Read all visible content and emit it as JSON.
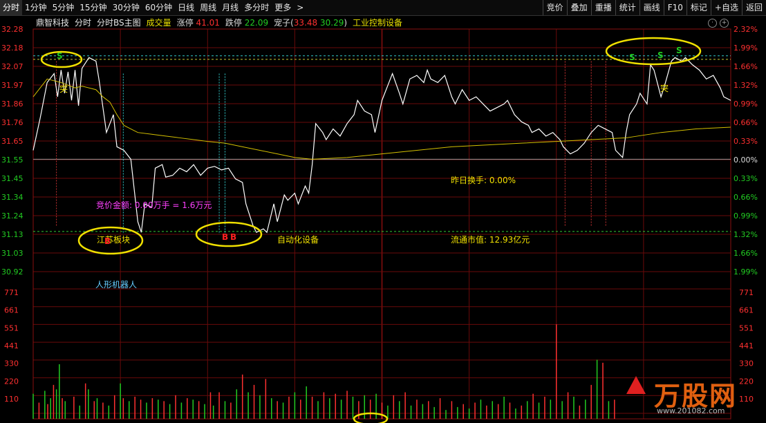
{
  "tabs": [
    {
      "label": "分时",
      "active": true
    },
    {
      "label": "1分钟"
    },
    {
      "label": "5分钟"
    },
    {
      "label": "15分钟"
    },
    {
      "label": "30分钟"
    },
    {
      "label": "60分钟"
    },
    {
      "label": "日线"
    },
    {
      "label": "周线"
    },
    {
      "label": "月线"
    },
    {
      "label": "多分时"
    },
    {
      "label": "更多"
    }
  ],
  "more_arrow": ">",
  "right_buttons": [
    "竞价",
    "叠加",
    "重播",
    "统计",
    "画线",
    "F10",
    "标记",
    "+自选",
    "返回"
  ],
  "info": {
    "stock_name": "鼎智科技",
    "chart_name": "分时",
    "indicator": "分时BS主图",
    "volume_label": "成交量",
    "limit_up_label": "涨停",
    "limit_up_value": "41.01",
    "limit_down_label": "跌停",
    "limit_down_value": "22.09",
    "pet_label": "宠子",
    "pet_open": "(",
    "pet_v1": "33.48",
    "pet_v2": "30.29",
    "pet_close": ")",
    "sector": "工业控制设备"
  },
  "colors": {
    "up": "#ff3030",
    "down": "#22cc22",
    "price_line": "#ffffff",
    "avg_line": "#d4c000",
    "yellow": "#f0e000",
    "magenta": "#ff40ff",
    "cyan": "#66ccff"
  },
  "annotations": {
    "turnover": "昨日换手: 0.00%",
    "auction": "竞价金额: 0.00万手 = 1.6万元",
    "float_mv": "流通市值: 12.93亿元",
    "concept1": "江苏板块",
    "concept2": "自动化设备",
    "concept3": "人形机器人",
    "tu1": "突",
    "tu2": "突",
    "b1": "B",
    "b2": "B",
    "b3": "B",
    "s1": "S",
    "s2": "S",
    "s3": "S",
    "s4": "S"
  },
  "watermark": "万股网",
  "watermark_url": "www.201082.com",
  "chart_data": {
    "type": "line",
    "price_axis": {
      "labels": [
        "32.28",
        "32.18",
        "32.07",
        "31.97",
        "31.86",
        "31.76",
        "31.65",
        "31.55",
        "31.45",
        "31.34",
        "31.24",
        "31.13",
        "31.03",
        "30.92"
      ]
    },
    "pct_axis": {
      "labels": [
        "2.32%",
        "1.99%",
        "1.66%",
        "1.32%",
        "0.99%",
        "0.66%",
        "0.33%",
        "0.00%",
        "0.33%",
        "0.66%",
        "0.99%",
        "1.32%",
        "1.66%",
        "1.99%"
      ]
    },
    "volume_axis": {
      "labels": [
        "771",
        "661",
        "551",
        "441",
        "330",
        "220",
        "110"
      ]
    },
    "ylim": [
      30.92,
      32.28
    ],
    "prev_close": 31.55,
    "series": [
      {
        "points": [
          [
            0,
            31.6
          ],
          [
            2,
            31.78
          ],
          [
            4,
            31.98
          ],
          [
            6,
            32.03
          ],
          [
            7,
            31.9
          ],
          [
            8,
            32.05
          ],
          [
            9,
            31.92
          ],
          [
            10,
            32.04
          ],
          [
            11,
            31.88
          ],
          [
            12,
            32.05
          ],
          [
            13,
            31.85
          ],
          [
            14,
            32.06
          ],
          [
            16,
            32.12
          ],
          [
            18,
            32.1
          ],
          [
            19,
            31.98
          ],
          [
            21,
            31.7
          ],
          [
            23,
            31.8
          ],
          [
            24,
            31.62
          ],
          [
            26,
            31.6
          ],
          [
            28,
            31.55
          ],
          [
            30,
            31.2
          ],
          [
            31,
            31.14
          ],
          [
            32,
            31.3
          ],
          [
            34,
            31.28
          ],
          [
            35,
            31.5
          ],
          [
            37,
            31.52
          ],
          [
            38,
            31.45
          ],
          [
            40,
            31.46
          ],
          [
            42,
            31.5
          ],
          [
            44,
            31.48
          ],
          [
            46,
            31.52
          ],
          [
            48,
            31.46
          ],
          [
            50,
            31.5
          ],
          [
            52,
            31.51
          ],
          [
            54,
            31.49
          ],
          [
            56,
            31.5
          ],
          [
            58,
            31.44
          ],
          [
            60,
            31.42
          ],
          [
            61,
            31.3
          ],
          [
            63,
            31.18
          ],
          [
            64,
            31.14
          ],
          [
            66,
            31.16
          ],
          [
            67,
            31.14
          ],
          [
            69,
            31.3
          ],
          [
            70,
            31.2
          ],
          [
            72,
            31.35
          ],
          [
            73,
            31.32
          ],
          [
            75,
            31.36
          ],
          [
            76,
            31.3
          ],
          [
            78,
            31.4
          ],
          [
            79,
            31.36
          ],
          [
            80,
            31.52
          ],
          [
            81,
            31.75
          ],
          [
            83,
            31.7
          ],
          [
            84,
            31.66
          ],
          [
            86,
            31.72
          ],
          [
            88,
            31.68
          ],
          [
            90,
            31.75
          ],
          [
            92,
            31.8
          ],
          [
            93,
            31.88
          ],
          [
            95,
            31.82
          ],
          [
            97,
            31.8
          ],
          [
            98,
            31.7
          ],
          [
            100,
            31.88
          ],
          [
            102,
            31.98
          ],
          [
            103,
            32.03
          ],
          [
            105,
            31.92
          ],
          [
            106,
            31.86
          ],
          [
            108,
            32.0
          ],
          [
            110,
            32.02
          ],
          [
            112,
            31.98
          ],
          [
            113,
            32.05
          ],
          [
            114,
            32.0
          ],
          [
            116,
            31.98
          ],
          [
            118,
            32.02
          ],
          [
            120,
            31.9
          ],
          [
            121,
            31.86
          ],
          [
            123,
            31.94
          ],
          [
            125,
            31.88
          ],
          [
            127,
            31.9
          ],
          [
            129,
            31.86
          ],
          [
            131,
            31.82
          ],
          [
            133,
            31.84
          ],
          [
            135,
            31.86
          ],
          [
            136,
            31.88
          ],
          [
            138,
            31.8
          ],
          [
            140,
            31.76
          ],
          [
            142,
            31.74
          ],
          [
            143,
            31.7
          ],
          [
            145,
            31.72
          ],
          [
            147,
            31.68
          ],
          [
            149,
            31.7
          ],
          [
            151,
            31.66
          ],
          [
            152,
            31.62
          ],
          [
            154,
            31.58
          ],
          [
            156,
            31.6
          ],
          [
            158,
            31.64
          ],
          [
            160,
            31.7
          ],
          [
            162,
            31.74
          ],
          [
            164,
            31.72
          ],
          [
            166,
            31.7
          ],
          [
            167,
            31.6
          ],
          [
            169,
            31.56
          ],
          [
            170,
            31.7
          ],
          [
            171,
            31.8
          ],
          [
            173,
            31.86
          ],
          [
            174,
            31.92
          ],
          [
            176,
            31.86
          ],
          [
            177,
            32.08
          ],
          [
            178,
            32.05
          ],
          [
            180,
            31.9
          ],
          [
            181,
            31.96
          ],
          [
            183,
            32.1
          ],
          [
            184,
            32.12
          ],
          [
            186,
            32.1
          ],
          [
            187,
            32.12
          ],
          [
            189,
            32.08
          ],
          [
            191,
            32.05
          ],
          [
            193,
            32.0
          ],
          [
            195,
            32.02
          ],
          [
            197,
            31.95
          ],
          [
            198,
            31.9
          ],
          [
            200,
            31.88
          ]
        ],
        "name": ""
      },
      {
        "points": [
          [
            0,
            31.9
          ],
          [
            4,
            32.0
          ],
          [
            8,
            31.98
          ],
          [
            12,
            31.95
          ],
          [
            14,
            31.96
          ],
          [
            18,
            31.94
          ],
          [
            20,
            31.9
          ],
          [
            22,
            31.87
          ],
          [
            24,
            31.8
          ],
          [
            26,
            31.74
          ],
          [
            28,
            31.72
          ],
          [
            30,
            31.7
          ],
          [
            34,
            31.69
          ],
          [
            38,
            31.68
          ],
          [
            42,
            31.67
          ],
          [
            46,
            31.66
          ],
          [
            50,
            31.65
          ],
          [
            55,
            31.64
          ],
          [
            60,
            31.62
          ],
          [
            65,
            31.6
          ],
          [
            70,
            31.58
          ],
          [
            75,
            31.56
          ],
          [
            80,
            31.55
          ],
          [
            90,
            31.56
          ],
          [
            100,
            31.58
          ],
          [
            110,
            31.6
          ],
          [
            120,
            31.62
          ],
          [
            130,
            31.63
          ],
          [
            140,
            31.64
          ],
          [
            150,
            31.65
          ],
          [
            160,
            31.66
          ],
          [
            170,
            31.67
          ],
          [
            180,
            31.7
          ],
          [
            190,
            31.72
          ],
          [
            200,
            31.73
          ]
        ],
        "name": ""
      }
    ],
    "volume": [
      [
        0,
        170,
        "down"
      ],
      [
        2,
        110,
        "up"
      ],
      [
        4,
        190,
        "down"
      ],
      [
        5,
        100,
        "up"
      ],
      [
        6,
        140,
        "down"
      ],
      [
        7,
        230,
        "up"
      ],
      [
        8,
        200,
        "down"
      ],
      [
        9,
        370,
        "down"
      ],
      [
        10,
        140,
        "up"
      ],
      [
        11,
        120,
        "down"
      ],
      [
        14,
        150,
        "up"
      ],
      [
        16,
        90,
        "down"
      ],
      [
        18,
        240,
        "up"
      ],
      [
        19,
        200,
        "down"
      ],
      [
        21,
        120,
        "up"
      ],
      [
        22,
        140,
        "down"
      ],
      [
        24,
        110,
        "up"
      ],
      [
        26,
        90,
        "down"
      ],
      [
        28,
        160,
        "up"
      ],
      [
        30,
        240,
        "down"
      ],
      [
        31,
        140,
        "up"
      ],
      [
        33,
        120,
        "down"
      ],
      [
        35,
        150,
        "up"
      ],
      [
        37,
        130,
        "up"
      ],
      [
        39,
        110,
        "down"
      ],
      [
        41,
        140,
        "up"
      ],
      [
        43,
        130,
        "down"
      ],
      [
        45,
        120,
        "up"
      ],
      [
        47,
        100,
        "down"
      ],
      [
        49,
        160,
        "up"
      ],
      [
        51,
        110,
        "down"
      ],
      [
        53,
        140,
        "up"
      ],
      [
        55,
        130,
        "down"
      ],
      [
        57,
        120,
        "up"
      ],
      [
        59,
        100,
        "down"
      ],
      [
        61,
        180,
        "up"
      ],
      [
        62,
        90,
        "down"
      ],
      [
        64,
        180,
        "up"
      ],
      [
        66,
        120,
        "down"
      ],
      [
        68,
        110,
        "up"
      ],
      [
        70,
        200,
        "down"
      ],
      [
        72,
        300,
        "up"
      ],
      [
        74,
        180,
        "down"
      ],
      [
        76,
        230,
        "up"
      ],
      [
        78,
        160,
        "down"
      ],
      [
        80,
        270,
        "up"
      ],
      [
        82,
        140,
        "down"
      ],
      [
        84,
        120,
        "up"
      ],
      [
        86,
        110,
        "down"
      ],
      [
        88,
        150,
        "up"
      ],
      [
        90,
        180,
        "down"
      ],
      [
        92,
        130,
        "up"
      ],
      [
        94,
        220,
        "down"
      ],
      [
        96,
        150,
        "up"
      ],
      [
        98,
        120,
        "down"
      ],
      [
        100,
        180,
        "up"
      ],
      [
        102,
        140,
        "down"
      ],
      [
        104,
        170,
        "up"
      ],
      [
        106,
        130,
        "down"
      ],
      [
        108,
        190,
        "up"
      ],
      [
        110,
        150,
        "down"
      ],
      [
        112,
        120,
        "up"
      ],
      [
        114,
        160,
        "down"
      ],
      [
        116,
        130,
        "up"
      ],
      [
        118,
        170,
        "down"
      ],
      [
        120,
        110,
        "up"
      ],
      [
        122,
        90,
        "down"
      ],
      [
        124,
        160,
        "up"
      ],
      [
        126,
        120,
        "down"
      ],
      [
        128,
        180,
        "up"
      ],
      [
        130,
        90,
        "down"
      ],
      [
        132,
        130,
        "up"
      ],
      [
        134,
        100,
        "down"
      ],
      [
        136,
        120,
        "up"
      ],
      [
        138,
        80,
        "down"
      ],
      [
        140,
        140,
        "up"
      ],
      [
        142,
        60,
        "down"
      ],
      [
        144,
        120,
        "up"
      ],
      [
        146,
        80,
        "down"
      ],
      [
        148,
        100,
        "up"
      ],
      [
        150,
        70,
        "down"
      ],
      [
        152,
        110,
        "up"
      ],
      [
        154,
        130,
        "down"
      ],
      [
        156,
        90,
        "up"
      ],
      [
        158,
        120,
        "down"
      ],
      [
        160,
        100,
        "up"
      ],
      [
        162,
        150,
        "down"
      ],
      [
        164,
        110,
        "up"
      ],
      [
        166,
        70,
        "down"
      ],
      [
        168,
        90,
        "up"
      ],
      [
        170,
        120,
        "down"
      ],
      [
        172,
        170,
        "up"
      ],
      [
        174,
        110,
        "down"
      ],
      [
        176,
        150,
        "up"
      ],
      [
        178,
        130,
        "down"
      ],
      [
        180,
        640,
        "up"
      ],
      [
        182,
        120,
        "down"
      ],
      [
        184,
        180,
        "up"
      ],
      [
        186,
        150,
        "down"
      ],
      [
        188,
        90,
        "up"
      ],
      [
        190,
        130,
        "down"
      ],
      [
        192,
        230,
        "up"
      ],
      [
        194,
        400,
        "down"
      ],
      [
        196,
        380,
        "up"
      ],
      [
        198,
        120,
        "down"
      ],
      [
        200,
        130,
        "up"
      ]
    ]
  }
}
